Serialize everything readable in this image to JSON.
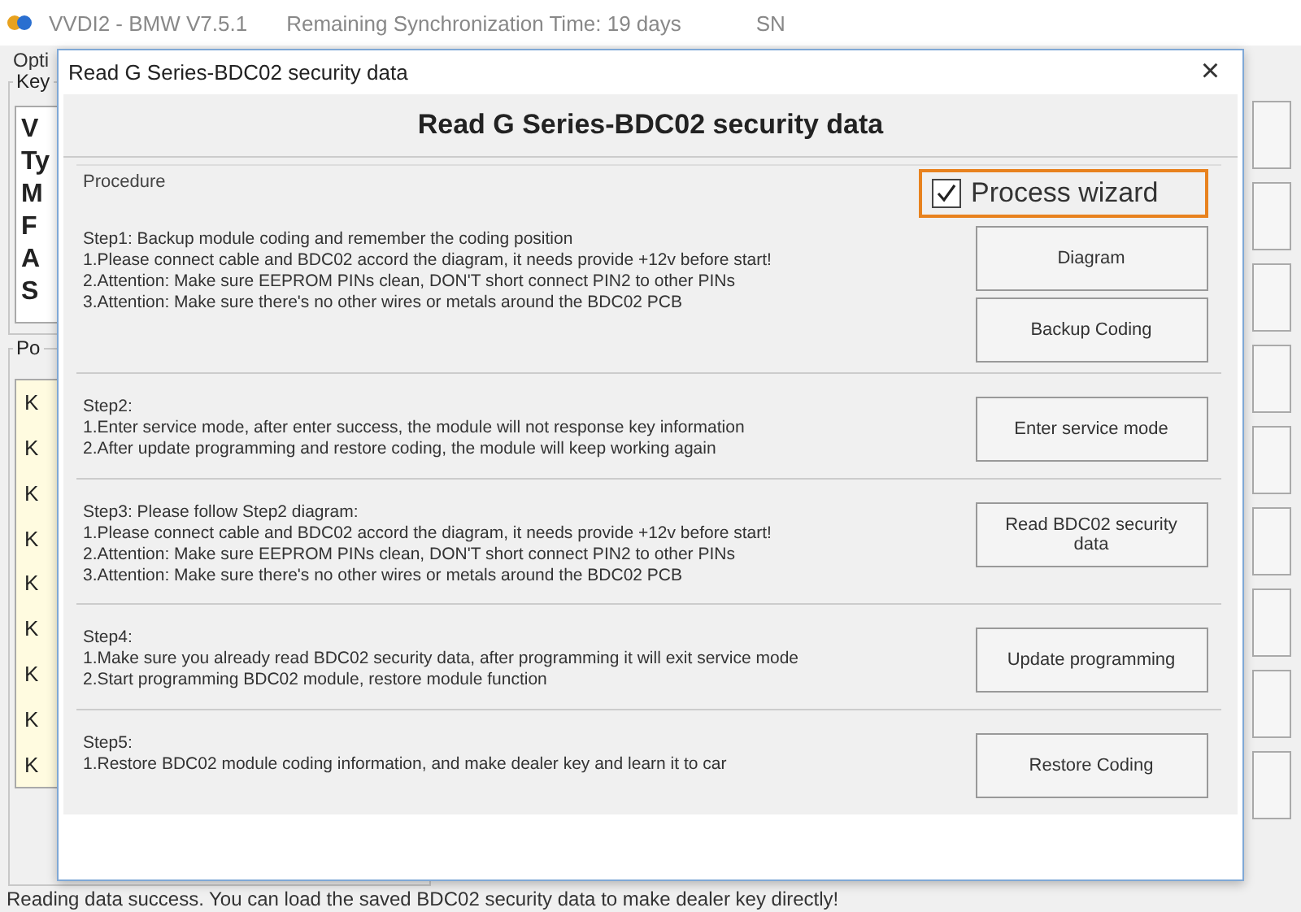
{
  "app": {
    "title": "VVDI2 - BMW V7.5.1",
    "sync": "Remaining Synchronization Time: 19 days",
    "sn_label": "SN",
    "menu": [
      "Opti"
    ],
    "key_group": {
      "label": "Key",
      "lines": [
        "V",
        "Ty",
        "M",
        "F",
        "A",
        "S"
      ]
    },
    "po_group": {
      "label": "Po",
      "items": [
        "K",
        "K",
        "K",
        "K",
        "K",
        "K",
        "K",
        "K",
        "K"
      ]
    },
    "status": "Reading data success. You can load the saved BDC02 security data to make dealer key directly!"
  },
  "dialog": {
    "title": "Read G Series-BDC02 security data",
    "close": "×",
    "heading": "Read G Series-BDC02 security data",
    "procedure_label": "Procedure",
    "wizard": {
      "label": "Process wizard",
      "checked": true
    },
    "steps": [
      {
        "lines": [
          "Step1: Backup module coding and remember the coding position",
          "1.Please connect cable and BDC02 accord the diagram, it needs provide +12v before start!",
          "2.Attention: Make sure EEPROM PINs clean, DON'T short connect PIN2 to other PINs",
          "3.Attention: Make sure there's no other wires or metals around the BDC02 PCB"
        ],
        "buttons": [
          "Diagram",
          "Backup Coding"
        ]
      },
      {
        "lines": [
          "Step2:",
          "1.Enter service mode, after enter success, the module will not response key information",
          "2.After update programming and restore coding, the module will keep working again"
        ],
        "buttons": [
          "Enter service mode"
        ]
      },
      {
        "lines": [
          "Step3: Please follow Step2 diagram:",
          "1.Please connect cable and BDC02 accord the diagram, it needs provide +12v before start!",
          "2.Attention: Make sure EEPROM PINs clean, DON'T short connect PIN2 to other PINs",
          "3.Attention: Make sure there's no other wires or metals around the BDC02 PCB"
        ],
        "buttons": [
          "Read BDC02 security data"
        ]
      },
      {
        "lines": [
          "Step4:",
          "1.Make sure you already read BDC02 security data, after programming it will exit service mode",
          "2.Start programming BDC02 module, restore module function"
        ],
        "buttons": [
          "Update programming"
        ]
      },
      {
        "lines": [
          "Step5:",
          "1.Restore BDC02 module coding information, and make dealer key and learn it to car"
        ],
        "buttons": [
          "Restore Coding"
        ]
      }
    ]
  }
}
